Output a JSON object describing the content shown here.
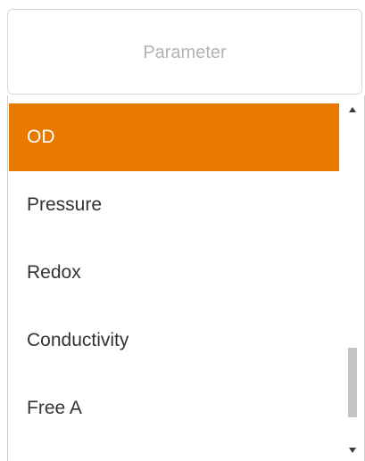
{
  "select": {
    "placeholder": "Parameter"
  },
  "options": [
    {
      "label": "OD",
      "selected": true
    },
    {
      "label": "Pressure",
      "selected": false
    },
    {
      "label": "Redox",
      "selected": false
    },
    {
      "label": "Conductivity",
      "selected": false
    },
    {
      "label": "Free A",
      "selected": false
    }
  ],
  "scrollbar": {
    "thumb_start_fraction": 0.72,
    "thumb_visible_fraction": 0.22,
    "up_icon": "triangle-up-icon",
    "down_icon": "triangle-down-icon"
  },
  "colors": {
    "selected_bg": "#e87a00",
    "selected_text": "#ffffff",
    "option_text": "#333333",
    "placeholder_text": "#b3b3b3",
    "scroll_thumb": "#c4c4c4"
  }
}
